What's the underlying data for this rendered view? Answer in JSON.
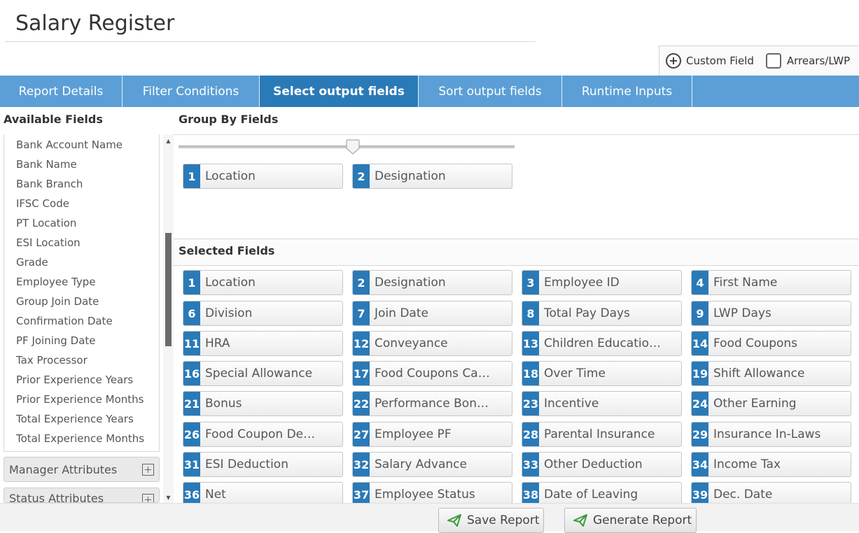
{
  "page": {
    "title": "Salary Register"
  },
  "toolbar": {
    "custom_field_label": "Custom Field",
    "arrears_label": "Arrears/LWP"
  },
  "tabs": [
    {
      "label": "Report Details",
      "active": false
    },
    {
      "label": "Filter Conditions",
      "active": false
    },
    {
      "label": "Select output fields",
      "active": true
    },
    {
      "label": "Sort output fields",
      "active": false
    },
    {
      "label": "Runtime Inputs",
      "active": false
    }
  ],
  "available_fields": {
    "header": "Available Fields",
    "items": [
      "Bank Account Name",
      "Bank Name",
      "Bank Branch",
      "IFSC Code",
      "PT Location",
      "ESI Location",
      "Grade",
      "Employee Type",
      "Group Join Date",
      "Confirmation Date",
      "PF Joining Date",
      "Tax Processor",
      "Prior Experience Years",
      "Prior Experience Months",
      "Total Experience Years",
      "Total Experience Months"
    ],
    "groups": [
      "Manager Attributes",
      "Status Attributes"
    ]
  },
  "group_by": {
    "header": "Group By Fields",
    "items": [
      {
        "num": "1",
        "label": "Location"
      },
      {
        "num": "2",
        "label": "Designation"
      }
    ]
  },
  "selected": {
    "header": "Selected Fields",
    "items": [
      {
        "num": "1",
        "label": "Location"
      },
      {
        "num": "2",
        "label": "Designation"
      },
      {
        "num": "3",
        "label": "Employee ID"
      },
      {
        "num": "4",
        "label": "First Name"
      },
      {
        "num": "6",
        "label": "Division"
      },
      {
        "num": "7",
        "label": "Join Date"
      },
      {
        "num": "8",
        "label": "Total Pay Days"
      },
      {
        "num": "9",
        "label": "LWP Days"
      },
      {
        "num": "11",
        "label": "HRA"
      },
      {
        "num": "12",
        "label": "Conveyance"
      },
      {
        "num": "13",
        "label": "Children Educatio…"
      },
      {
        "num": "14",
        "label": "Food Coupons"
      },
      {
        "num": "16",
        "label": "Special Allowance"
      },
      {
        "num": "17",
        "label": "Food Coupons Ca…"
      },
      {
        "num": "18",
        "label": "Over Time"
      },
      {
        "num": "19",
        "label": "Shift Allowance"
      },
      {
        "num": "21",
        "label": "Bonus"
      },
      {
        "num": "22",
        "label": "Performance Bon…"
      },
      {
        "num": "23",
        "label": "Incentive"
      },
      {
        "num": "24",
        "label": "Other Earning"
      },
      {
        "num": "26",
        "label": "Food Coupon De…"
      },
      {
        "num": "27",
        "label": "Employee PF"
      },
      {
        "num": "28",
        "label": "Parental Insurance"
      },
      {
        "num": "29",
        "label": "Insurance In-Laws"
      },
      {
        "num": "31",
        "label": "ESI Deduction"
      },
      {
        "num": "32",
        "label": "Salary Advance"
      },
      {
        "num": "33",
        "label": "Other Deduction"
      },
      {
        "num": "34",
        "label": "Income Tax"
      },
      {
        "num": "36",
        "label": "Net"
      },
      {
        "num": "37",
        "label": "Employee Status"
      },
      {
        "num": "38",
        "label": "Date of Leaving"
      },
      {
        "num": "39",
        "label": "Dec. Date"
      }
    ]
  },
  "footer": {
    "save_label": "Save Report",
    "generate_label": "Generate Report"
  },
  "colors": {
    "tab_bar": "#5b9fd6",
    "tab_active": "#2a7ab8",
    "chip_number": "#2a7ab8",
    "send_icon": "#3a9a3a"
  }
}
